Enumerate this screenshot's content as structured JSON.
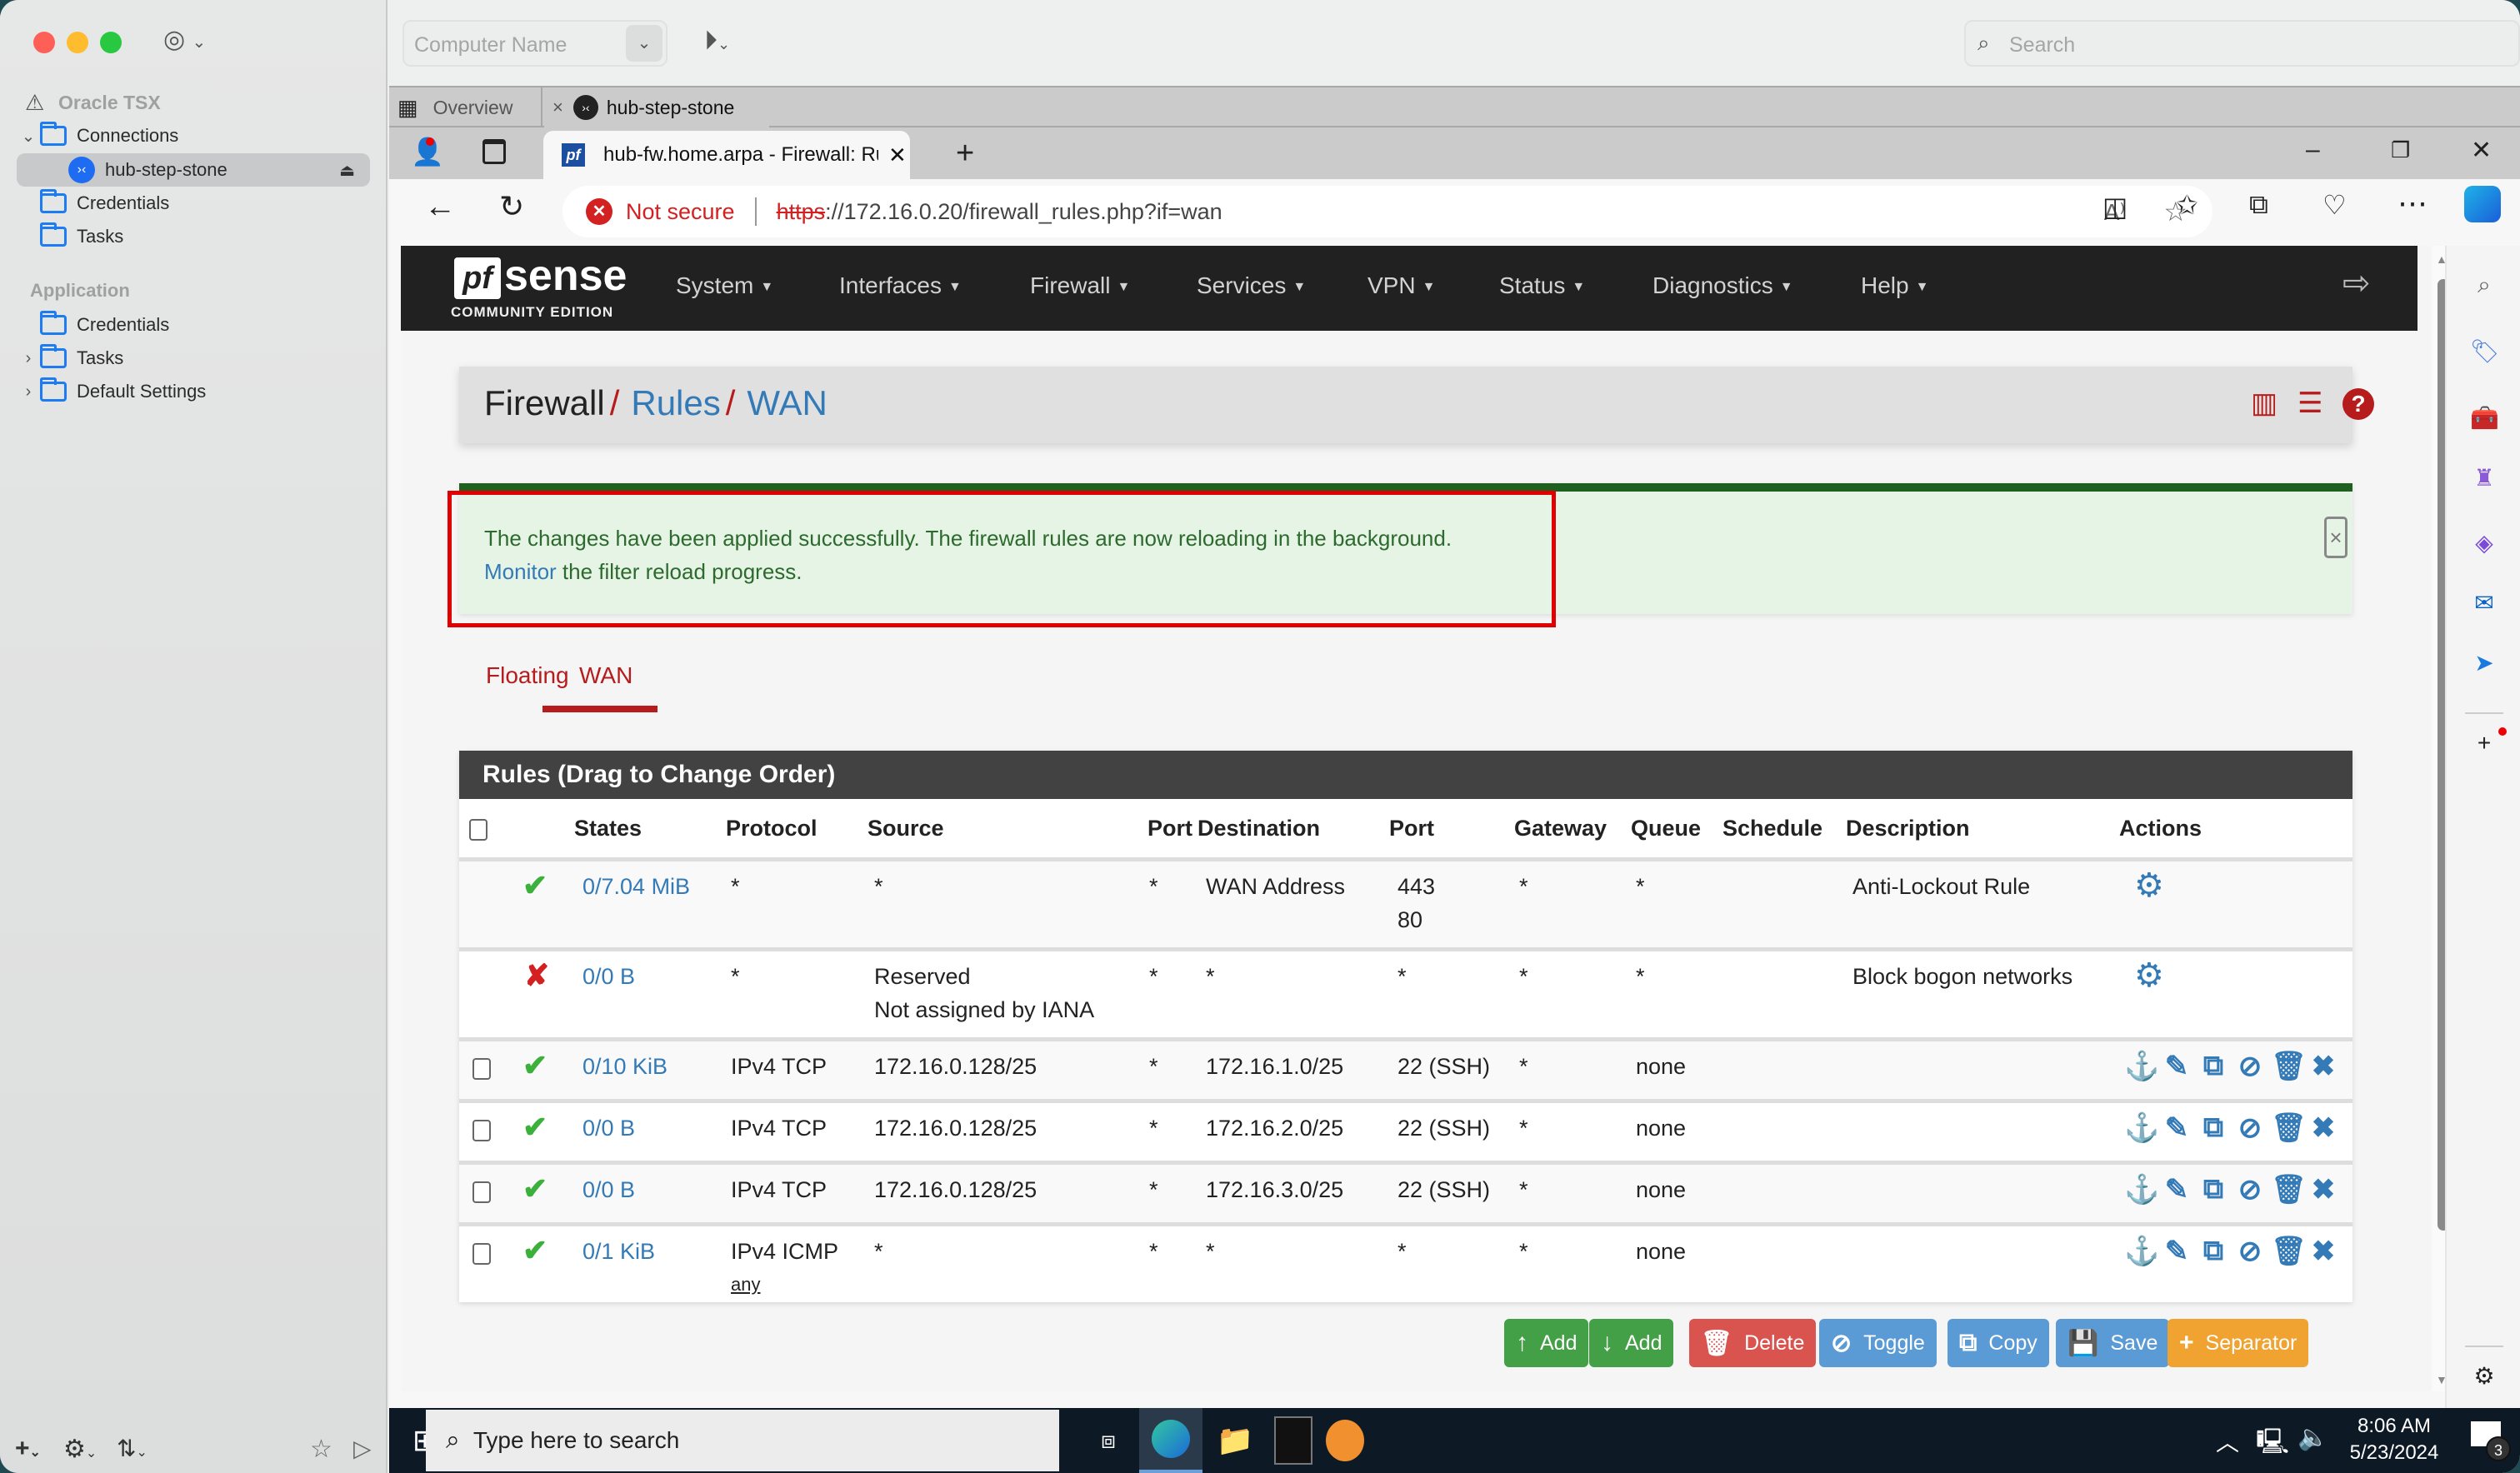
{
  "royal": {
    "sidebar": {
      "document_name": "Oracle TSX",
      "items": [
        {
          "label": "Connections",
          "type": "folder",
          "expanded": true
        },
        {
          "label": "hub-step-stone",
          "type": "connection",
          "selected": true
        },
        {
          "label": "Credentials",
          "type": "folder"
        },
        {
          "label": "Tasks",
          "type": "folder"
        }
      ],
      "application_header": "Application",
      "application_items": [
        {
          "label": "Credentials",
          "type": "folder"
        },
        {
          "label": "Tasks",
          "type": "folder",
          "collapsed": true
        },
        {
          "label": "Default Settings",
          "type": "folder",
          "collapsed": true
        }
      ]
    },
    "toolbar": {
      "computer_name_placeholder": "Computer Name",
      "search_placeholder": "Search"
    },
    "tabs": [
      {
        "label": "Overview",
        "icon": "grid-icon"
      },
      {
        "label": "hub-step-stone",
        "icon": "remote-desktop-icon",
        "active": true
      }
    ]
  },
  "browser": {
    "tab_title": "hub-fw.home.arpa - Firewall: Rul",
    "security_label": "Not secure",
    "url_scheme": "https",
    "url_rest": "://172.16.0.20/firewall_rules.php?if=wan"
  },
  "pfsense": {
    "logo_text": "sense",
    "logo_pf": "pf",
    "edition": "COMMUNITY EDITION",
    "menu": [
      "System",
      "Interfaces",
      "Firewall",
      "Services",
      "VPN",
      "Status",
      "Diagnostics",
      "Help"
    ],
    "breadcrumb": {
      "root": "Firewall",
      "sep": "/",
      "level2": "Rules",
      "level3": "WAN"
    },
    "alert": {
      "line1": "The changes have been applied successfully. The firewall rules are now reloading in the background.",
      "link": "Monitor",
      "line2_rest": " the filter reload progress.",
      "close": "×"
    },
    "tabs": [
      {
        "label": "Floating",
        "active": false
      },
      {
        "label": "WAN",
        "active": true
      }
    ],
    "panel_title": "Rules (Drag to Change Order)",
    "columns": [
      "States",
      "Protocol",
      "Source",
      "Port",
      "Destination",
      "Port",
      "Gateway",
      "Queue",
      "Schedule",
      "Description",
      "Actions"
    ],
    "rules": [
      {
        "checkbox": false,
        "status": "pass",
        "states": "0/7.04 MiB",
        "protocol": "*",
        "protocol2": "",
        "source": "*",
        "source2": "",
        "sport": "*",
        "destination": "WAN Address",
        "dport": "443",
        "dport2": "80",
        "gateway": "*",
        "queue": "*",
        "schedule": "",
        "description": "Anti-Lockout Rule",
        "actions": "settings"
      },
      {
        "checkbox": false,
        "status": "block",
        "states": "0/0 B",
        "protocol": "*",
        "protocol2": "",
        "source": "Reserved",
        "source2": "Not assigned by IANA",
        "sport": "*",
        "destination": "*",
        "dport": "*",
        "dport2": "",
        "gateway": "*",
        "queue": "*",
        "schedule": "",
        "description": "Block bogon networks",
        "actions": "settings"
      },
      {
        "checkbox": true,
        "status": "pass",
        "states": "0/10 KiB",
        "protocol": "IPv4 TCP",
        "protocol2": "",
        "source": "172.16.0.128/25",
        "source2": "",
        "sport": "*",
        "destination": "172.16.1.0/25",
        "dport": "22 (SSH)",
        "dport2": "",
        "gateway": "*",
        "queue": "none",
        "schedule": "",
        "description": "",
        "actions": "full"
      },
      {
        "checkbox": true,
        "status": "pass",
        "states": "0/0 B",
        "protocol": "IPv4 TCP",
        "protocol2": "",
        "source": "172.16.0.128/25",
        "source2": "",
        "sport": "*",
        "destination": "172.16.2.0/25",
        "dport": "22 (SSH)",
        "dport2": "",
        "gateway": "*",
        "queue": "none",
        "schedule": "",
        "description": "",
        "actions": "full"
      },
      {
        "checkbox": true,
        "status": "pass",
        "states": "0/0 B",
        "protocol": "IPv4 TCP",
        "protocol2": "",
        "source": "172.16.0.128/25",
        "source2": "",
        "sport": "*",
        "destination": "172.16.3.0/25",
        "dport": "22 (SSH)",
        "dport2": "",
        "gateway": "*",
        "queue": "none",
        "schedule": "",
        "description": "",
        "actions": "full"
      },
      {
        "checkbox": true,
        "status": "pass",
        "states": "0/1 KiB",
        "protocol": "IPv4 ICMP",
        "protocol2": "any",
        "source": "*",
        "source2": "",
        "sport": "*",
        "destination": "*",
        "dport": "*",
        "dport2": "",
        "gateway": "*",
        "queue": "none",
        "schedule": "",
        "description": "",
        "actions": "full"
      }
    ],
    "buttons": [
      {
        "label": "Add",
        "icon": "arrow-up-icon",
        "color": "#43a047"
      },
      {
        "label": "Add",
        "icon": "arrow-down-icon",
        "color": "#43a047"
      },
      {
        "label": "Delete",
        "icon": "trash-icon",
        "color": "#d9534f"
      },
      {
        "label": "Toggle",
        "icon": "ban-icon",
        "color": "#5b9bd5"
      },
      {
        "label": "Copy",
        "icon": "copy-icon",
        "color": "#5b9bd5"
      },
      {
        "label": "Save",
        "icon": "save-icon",
        "color": "#5b9bd5"
      },
      {
        "label": "Separator",
        "icon": "plus-icon",
        "color": "#f0a330"
      }
    ],
    "colors": {
      "accent_red": "#b71c1c",
      "link_blue": "#337ab7",
      "pass_green": "#3bb13b",
      "block_red": "#d42020",
      "alert_green": "#1f5f1f"
    }
  },
  "taskbar": {
    "search_placeholder": "Type here to search",
    "time": "8:06 AM",
    "date": "5/23/2024",
    "notification_count": "3"
  }
}
